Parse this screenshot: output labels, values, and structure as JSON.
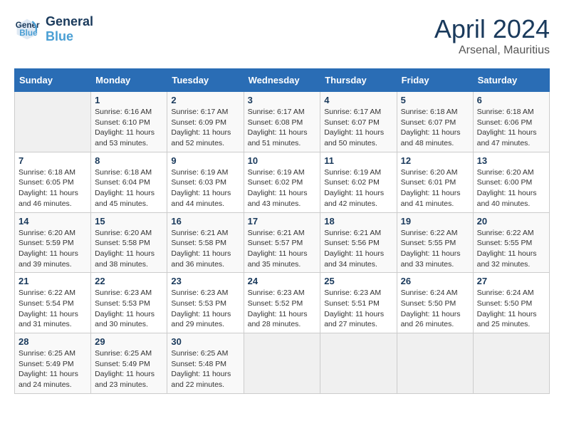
{
  "header": {
    "logo_line1": "General",
    "logo_line2": "Blue",
    "month": "April 2024",
    "location": "Arsenal, Mauritius"
  },
  "days_of_week": [
    "Sunday",
    "Monday",
    "Tuesday",
    "Wednesday",
    "Thursday",
    "Friday",
    "Saturday"
  ],
  "weeks": [
    [
      {
        "day": "",
        "info": ""
      },
      {
        "day": "1",
        "info": "Sunrise: 6:16 AM\nSunset: 6:10 PM\nDaylight: 11 hours\nand 53 minutes."
      },
      {
        "day": "2",
        "info": "Sunrise: 6:17 AM\nSunset: 6:09 PM\nDaylight: 11 hours\nand 52 minutes."
      },
      {
        "day": "3",
        "info": "Sunrise: 6:17 AM\nSunset: 6:08 PM\nDaylight: 11 hours\nand 51 minutes."
      },
      {
        "day": "4",
        "info": "Sunrise: 6:17 AM\nSunset: 6:07 PM\nDaylight: 11 hours\nand 50 minutes."
      },
      {
        "day": "5",
        "info": "Sunrise: 6:18 AM\nSunset: 6:07 PM\nDaylight: 11 hours\nand 48 minutes."
      },
      {
        "day": "6",
        "info": "Sunrise: 6:18 AM\nSunset: 6:06 PM\nDaylight: 11 hours\nand 47 minutes."
      }
    ],
    [
      {
        "day": "7",
        "info": "Sunrise: 6:18 AM\nSunset: 6:05 PM\nDaylight: 11 hours\nand 46 minutes."
      },
      {
        "day": "8",
        "info": "Sunrise: 6:18 AM\nSunset: 6:04 PM\nDaylight: 11 hours\nand 45 minutes."
      },
      {
        "day": "9",
        "info": "Sunrise: 6:19 AM\nSunset: 6:03 PM\nDaylight: 11 hours\nand 44 minutes."
      },
      {
        "day": "10",
        "info": "Sunrise: 6:19 AM\nSunset: 6:02 PM\nDaylight: 11 hours\nand 43 minutes."
      },
      {
        "day": "11",
        "info": "Sunrise: 6:19 AM\nSunset: 6:02 PM\nDaylight: 11 hours\nand 42 minutes."
      },
      {
        "day": "12",
        "info": "Sunrise: 6:20 AM\nSunset: 6:01 PM\nDaylight: 11 hours\nand 41 minutes."
      },
      {
        "day": "13",
        "info": "Sunrise: 6:20 AM\nSunset: 6:00 PM\nDaylight: 11 hours\nand 40 minutes."
      }
    ],
    [
      {
        "day": "14",
        "info": "Sunrise: 6:20 AM\nSunset: 5:59 PM\nDaylight: 11 hours\nand 39 minutes."
      },
      {
        "day": "15",
        "info": "Sunrise: 6:20 AM\nSunset: 5:58 PM\nDaylight: 11 hours\nand 38 minutes."
      },
      {
        "day": "16",
        "info": "Sunrise: 6:21 AM\nSunset: 5:58 PM\nDaylight: 11 hours\nand 36 minutes."
      },
      {
        "day": "17",
        "info": "Sunrise: 6:21 AM\nSunset: 5:57 PM\nDaylight: 11 hours\nand 35 minutes."
      },
      {
        "day": "18",
        "info": "Sunrise: 6:21 AM\nSunset: 5:56 PM\nDaylight: 11 hours\nand 34 minutes."
      },
      {
        "day": "19",
        "info": "Sunrise: 6:22 AM\nSunset: 5:55 PM\nDaylight: 11 hours\nand 33 minutes."
      },
      {
        "day": "20",
        "info": "Sunrise: 6:22 AM\nSunset: 5:55 PM\nDaylight: 11 hours\nand 32 minutes."
      }
    ],
    [
      {
        "day": "21",
        "info": "Sunrise: 6:22 AM\nSunset: 5:54 PM\nDaylight: 11 hours\nand 31 minutes."
      },
      {
        "day": "22",
        "info": "Sunrise: 6:23 AM\nSunset: 5:53 PM\nDaylight: 11 hours\nand 30 minutes."
      },
      {
        "day": "23",
        "info": "Sunrise: 6:23 AM\nSunset: 5:53 PM\nDaylight: 11 hours\nand 29 minutes."
      },
      {
        "day": "24",
        "info": "Sunrise: 6:23 AM\nSunset: 5:52 PM\nDaylight: 11 hours\nand 28 minutes."
      },
      {
        "day": "25",
        "info": "Sunrise: 6:23 AM\nSunset: 5:51 PM\nDaylight: 11 hours\nand 27 minutes."
      },
      {
        "day": "26",
        "info": "Sunrise: 6:24 AM\nSunset: 5:50 PM\nDaylight: 11 hours\nand 26 minutes."
      },
      {
        "day": "27",
        "info": "Sunrise: 6:24 AM\nSunset: 5:50 PM\nDaylight: 11 hours\nand 25 minutes."
      }
    ],
    [
      {
        "day": "28",
        "info": "Sunrise: 6:25 AM\nSunset: 5:49 PM\nDaylight: 11 hours\nand 24 minutes."
      },
      {
        "day": "29",
        "info": "Sunrise: 6:25 AM\nSunset: 5:49 PM\nDaylight: 11 hours\nand 23 minutes."
      },
      {
        "day": "30",
        "info": "Sunrise: 6:25 AM\nSunset: 5:48 PM\nDaylight: 11 hours\nand 22 minutes."
      },
      {
        "day": "",
        "info": ""
      },
      {
        "day": "",
        "info": ""
      },
      {
        "day": "",
        "info": ""
      },
      {
        "day": "",
        "info": ""
      }
    ]
  ]
}
